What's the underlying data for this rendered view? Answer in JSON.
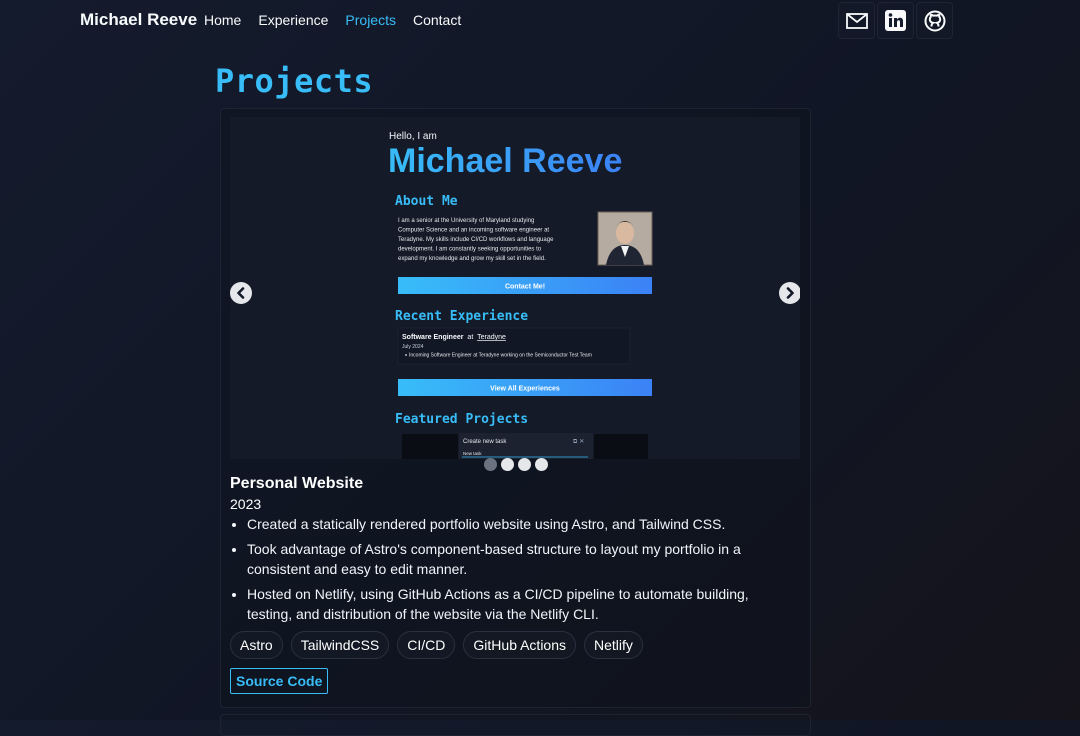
{
  "header": {
    "brand": "Michael Reeve",
    "nav": [
      "Home",
      "Experience",
      "Projects",
      "Contact"
    ],
    "active_nav": "Projects",
    "social_icons": [
      "mail-icon",
      "linkedin-icon",
      "github-icon"
    ]
  },
  "page": {
    "title": "Projects"
  },
  "project": {
    "name": "Personal Website",
    "year": "2023",
    "bullets": [
      "Created a statically rendered portfolio website using Astro, and Tailwind CSS.",
      "Took advantage of Astro's component-based structure to layout my portfolio in a consistent and easy to edit manner.",
      "Hosted on Netlify, using GitHub Actions as a CI/CD pipeline to automate building, testing, and distribution of the website via the Netlify CLI."
    ],
    "tags": [
      "Astro",
      "TailwindCSS",
      "CI/CD",
      "GitHub Actions",
      "Netlify"
    ],
    "source_label": "Source Code",
    "carousel": {
      "active_index": 0,
      "slide_count": 4,
      "slide": {
        "greeting": "Hello, I am",
        "name": "Michael Reeve",
        "about_heading": "About Me",
        "about_lines": [
          "I am a senior at the University of Maryland studying",
          "Computer Science and an incoming software engineer at",
          "Teradyne. My skills include CI/CD workflows and language",
          "development. I am constantly seeking opportunities to",
          "expand my knowledge and grow my skill set in the field."
        ],
        "contact_button": "Contact Me!",
        "experience_heading": "Recent Experience",
        "exp_role": "Software Engineer",
        "exp_at": "at",
        "exp_company": "Teradyne",
        "exp_date": "July 2024",
        "exp_bullet": "Incoming Software Engineer at Teradyne working on the Semiconductor Test Team",
        "view_all_button": "View All Experiences",
        "featured_heading": "Featured Projects",
        "task_title": "Create new task",
        "task_input": "New task"
      }
    }
  },
  "colors": {
    "accent": "#38bdf8",
    "gradient_end": "#3b82f6"
  }
}
